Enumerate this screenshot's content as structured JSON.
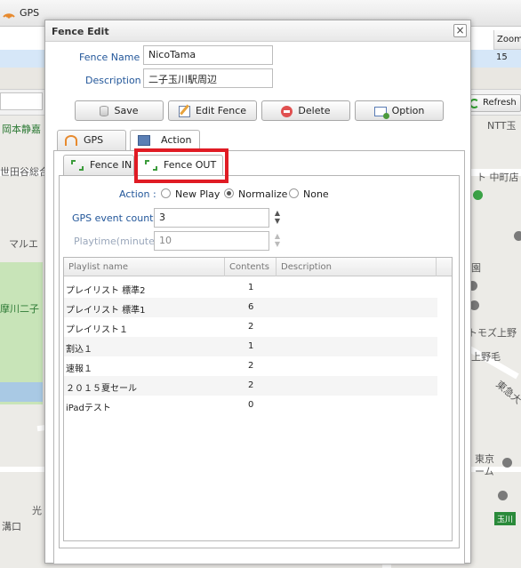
{
  "app": {
    "title": "GPS",
    "grid_header_zoom": "Zoom",
    "grid_zoom_value": "15",
    "refresh_label": "Refresh"
  },
  "map_labels": {
    "okamoto": "岡本静嘉",
    "setagaya": "世田谷総合",
    "marue": "マルエ",
    "tamagawa": "摩川二子",
    "hikari": "光",
    "mizoguchi": "溝口",
    "ntt": "NTT玉",
    "nakamachi": "ト 中町店",
    "en": "園",
    "tomozu": "トモズ上野",
    "kaminoge": "上野毛",
    "tokyu": "東急大",
    "tokyo": "東京",
    "room": "ーム",
    "tamagawa_badge": "玉川"
  },
  "dialog": {
    "title": "Fence Edit",
    "close_glyph": "×",
    "fence_name_label": "Fence Name :",
    "fence_name_value": "NicoTama",
    "description_label": "Description :",
    "description_value": "二子玉川駅周辺",
    "buttons": {
      "save": "Save",
      "edit_fence": "Edit Fence",
      "delete": "Delete",
      "option": "Option"
    },
    "tabs": [
      {
        "label": "GPS",
        "active": false
      },
      {
        "label": "Action",
        "active": true
      }
    ],
    "subtabs": [
      {
        "label": "Fence IN",
        "active": false
      },
      {
        "label": "Fence OUT",
        "active": true
      }
    ],
    "action": {
      "label": "Action :",
      "options": [
        "New Play",
        "Normalize",
        "None"
      ],
      "selected": "Normalize"
    },
    "gps_event_count": {
      "label": "GPS event count :",
      "value": "3"
    },
    "playtime": {
      "label": "Playtime(minute) :",
      "value": "10"
    },
    "playlist": {
      "columns": [
        "Playlist name",
        "Contents",
        "Description"
      ],
      "rows": [
        {
          "name": "プレイリスト 標準2",
          "contents": "1",
          "description": ""
        },
        {
          "name": "プレイリスト 標準1",
          "contents": "6",
          "description": ""
        },
        {
          "name": "プレイリスト１",
          "contents": "2",
          "description": ""
        },
        {
          "name": "割込１",
          "contents": "1",
          "description": ""
        },
        {
          "name": "速報１",
          "contents": "2",
          "description": ""
        },
        {
          "name": "２０１５夏セール",
          "contents": "2",
          "description": ""
        },
        {
          "name": "iPadテスト",
          "contents": "0",
          "description": ""
        }
      ]
    }
  },
  "colors": {
    "highlight": "#e01b24",
    "label_blue": "#23579a",
    "selected_row": "#d6e7f8"
  }
}
